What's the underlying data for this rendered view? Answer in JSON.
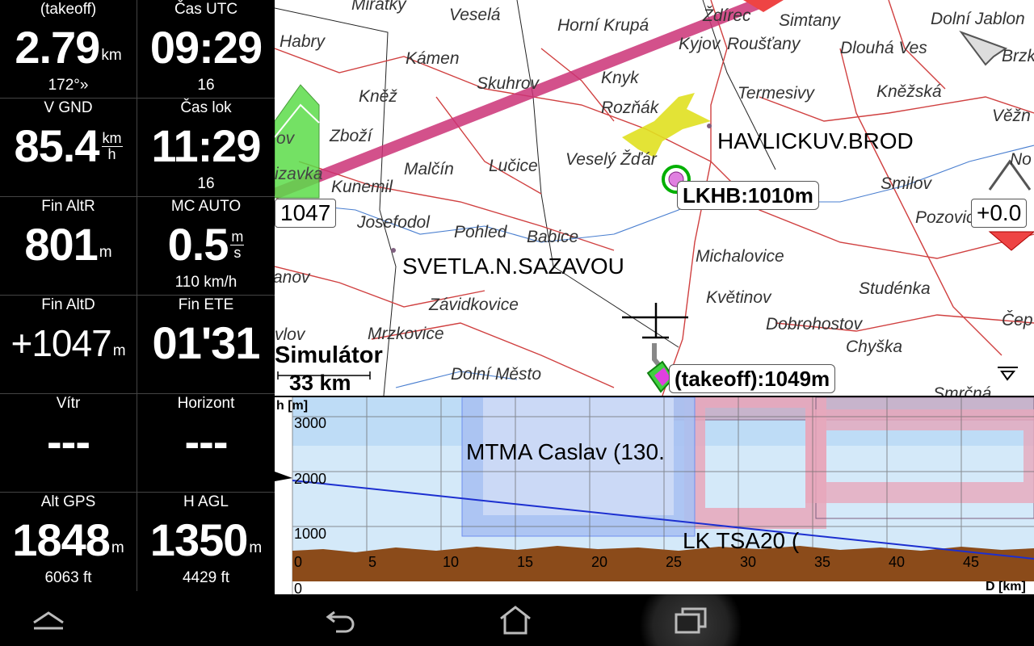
{
  "infoboxes": [
    {
      "title": "(takeoff)",
      "value": "2.79",
      "unit": "km",
      "comment": "172°»"
    },
    {
      "title": "Čas UTC",
      "value": "09:29",
      "unit": "",
      "comment": "16"
    },
    {
      "title": "V GND",
      "value": "85.4",
      "unit_num": "km",
      "unit_den": "h",
      "comment": ""
    },
    {
      "title": "Čas lok",
      "value": "11:29",
      "unit": "",
      "comment": "16"
    },
    {
      "title": "Fin AltR",
      "value": "801",
      "unit": "m",
      "comment": ""
    },
    {
      "title": "MC AUTO",
      "value": "0.5",
      "unit_num": "m",
      "unit_den": "s",
      "comment": "110 km/h"
    },
    {
      "title": "Fin AltD",
      "value": "+1047",
      "unit": "m",
      "comment": ""
    },
    {
      "title": "Fin ETE",
      "value": "01'31",
      "unit": "",
      "comment": ""
    },
    {
      "title": "Vítr",
      "value": "---",
      "unit": "",
      "comment": ""
    },
    {
      "title": "Horizont",
      "value": "---",
      "unit": "",
      "comment": ""
    },
    {
      "title": "Alt GPS",
      "value": "1848",
      "unit": "m",
      "comment": "6063 ft"
    },
    {
      "title": "H AGL",
      "value": "1350",
      "unit": "m",
      "comment": "4429 ft"
    }
  ],
  "map": {
    "towns": [
      "Miratky",
      "Veselá",
      "Habry",
      "Horní Krupá",
      "Ždírec",
      "Simtany",
      "Dolní Jablon",
      "Kámen",
      "Kyjov",
      "Roušťany",
      "Dlouhá Ves",
      "Brzk",
      "Skuhrov",
      "Knyk",
      "Kněž",
      "Termesivy",
      "Kněžská",
      "Rozňák",
      "Věžn",
      "Zboží",
      "Veselý Žďár",
      "No",
      "Malčín",
      "Lučice",
      "Smilov",
      "Kunemil",
      "Pozovice",
      "Josefodol",
      "Pohled",
      "Babice",
      "Michalovice",
      "anov",
      "Květinov",
      "Studénka",
      "Závidkovice",
      "Mrzkovice",
      "Dobrohostov",
      "Čep",
      "vlov",
      "Chyška",
      "Dolní Město",
      "Smrčná",
      "ov",
      "izavka"
    ],
    "big_towns": [
      "HAVLICKUV.BROD",
      "SVETLA.N.SAZAVOU"
    ],
    "waypoint_labels": [
      "LKHB:1010m",
      "(takeoff):1049m",
      "1047",
      "+0.0"
    ],
    "simulator_text": "Simulátor",
    "scale_text": "33 km"
  },
  "xsection": {
    "axis_h_label": "h [m]",
    "axis_d_label": "D [km]",
    "alt_ticks": [
      "3000",
      "2000",
      "1000",
      "0"
    ],
    "dist_ticks": [
      "0",
      "5",
      "10",
      "15",
      "20",
      "25",
      "30",
      "35",
      "40",
      "45"
    ],
    "airspace_labels": [
      "MTMA Caslav (130.",
      "LK TSA20 ("
    ]
  },
  "colors": {
    "task_line": "#cc3377",
    "airspace_blue": "#6f8ff0",
    "airspace_pink": "#e0a0b8",
    "terrain": "#8b4b1a",
    "sky": "#cfe6f8"
  },
  "navbar": {
    "icons": [
      "menu-up-icon",
      "back-icon",
      "home-icon",
      "recent-apps-icon"
    ]
  }
}
